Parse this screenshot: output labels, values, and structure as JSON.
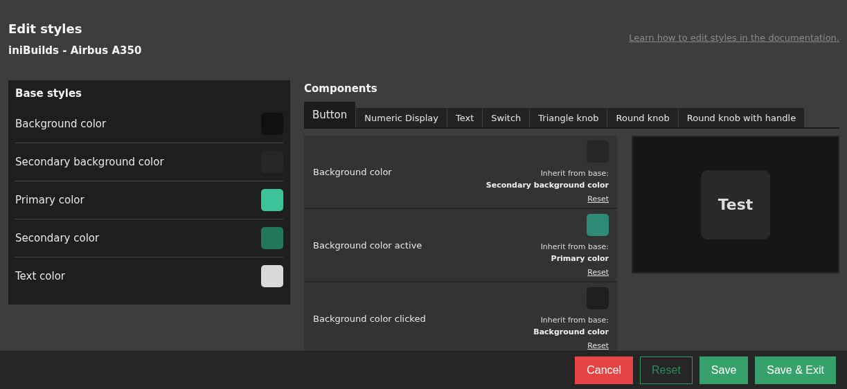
{
  "header": {
    "title": "Edit styles",
    "subtitle": "iniBuilds - Airbus A350",
    "doc_link": "Learn how to edit styles in the documentation."
  },
  "base_styles": {
    "title": "Base styles",
    "items": [
      {
        "label": "Background color",
        "color": "#101010"
      },
      {
        "label": "Secondary background color",
        "color": "#262626"
      },
      {
        "label": "Primary color",
        "color": "#3ec49a"
      },
      {
        "label": "Secondary color",
        "color": "#22765c"
      },
      {
        "label": "Text color",
        "color": "#d9d9d9"
      }
    ]
  },
  "components": {
    "title": "Components",
    "tabs": [
      {
        "label": "Button",
        "selected": true
      },
      {
        "label": "Numeric Display",
        "selected": false
      },
      {
        "label": "Text",
        "selected": false
      },
      {
        "label": "Switch",
        "selected": false
      },
      {
        "label": "Triangle knob",
        "selected": false
      },
      {
        "label": "Round knob",
        "selected": false
      },
      {
        "label": "Round knob with handle",
        "selected": false
      }
    ],
    "properties": [
      {
        "label": "Background color",
        "color": "#262626",
        "inherit_label": "Inherit from base:",
        "inherit_from": "Secondary background color",
        "reset": "Reset"
      },
      {
        "label": "Background color active",
        "color": "#2e8a73",
        "inherit_label": "Inherit from base:",
        "inherit_from": "Primary color",
        "reset": "Reset"
      },
      {
        "label": "Background color clicked",
        "color": "#1e1e1e",
        "inherit_label": "Inherit from base:",
        "inherit_from": "Background color",
        "reset": "Reset"
      }
    ],
    "preview": {
      "button_label": "Test"
    }
  },
  "actions": [
    {
      "label": "Cancel",
      "kind": "danger"
    },
    {
      "label": "Reset",
      "kind": "outline"
    },
    {
      "label": "Save",
      "kind": "primary"
    },
    {
      "label": "Save & Exit",
      "kind": "primary"
    }
  ]
}
